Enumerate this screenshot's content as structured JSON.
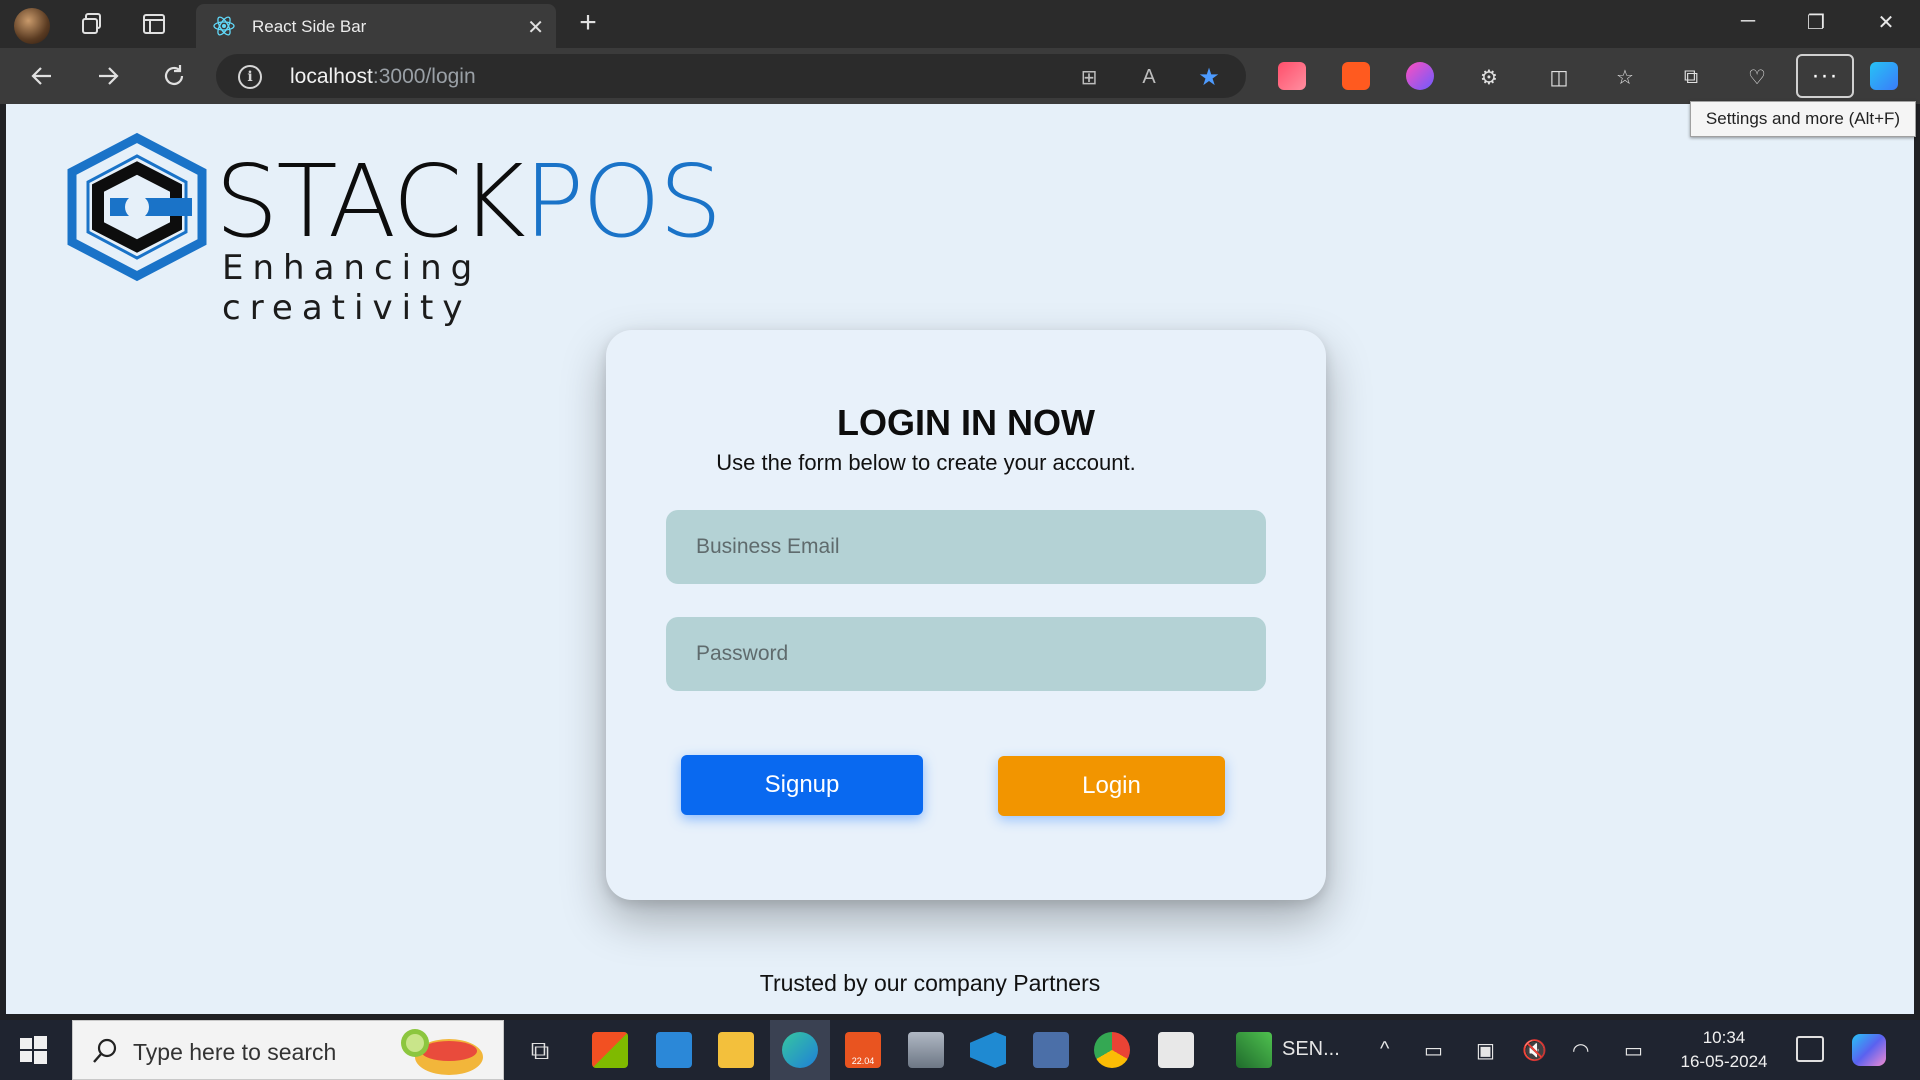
{
  "browser": {
    "tab_title": "React Side Bar",
    "url_host": "localhost",
    "url_path": ":3000/login",
    "tooltip": "Settings and more (Alt+F)",
    "more_label": "···"
  },
  "page": {
    "brand_stack": "STACK",
    "brand_pos": "POS",
    "tagline": "Enhancing creativity",
    "card": {
      "title": "LOGIN IN NOW",
      "subtitle": "Use the form below to create your account.",
      "email_placeholder": "Business Email",
      "password_placeholder": "Password",
      "signup_label": "Signup",
      "login_label": "Login"
    },
    "trusted": "Trusted by our company Partners",
    "colors": {
      "brand_blue": "#1a73c8",
      "signup": "#0969f0",
      "login": "#f29500",
      "field": "#b4d2d5",
      "background": "#e6f0f9"
    }
  },
  "taskbar": {
    "search_placeholder": "Type here to search",
    "app_label": "SEN...",
    "ubuntu_badge": "22.04",
    "time": "10:34",
    "date": "16-05-2024"
  }
}
